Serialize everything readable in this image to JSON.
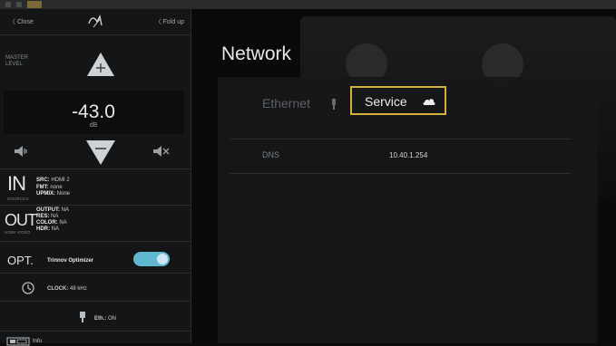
{
  "sidebar": {
    "close_label": "〈 Close",
    "fold_label": "〈 Fold up",
    "master_level_label_1": "MASTER",
    "master_level_label_2": "LEVEL",
    "volume_value": "-43.0",
    "volume_unit": "dB",
    "input": {
      "big": "IN",
      "sub": "SOURCES",
      "lines": [
        {
          "key": "SRC:",
          "value": "HDMI 2"
        },
        {
          "key": "FMT:",
          "value": "none"
        },
        {
          "key": "UPMIX:",
          "value": "None"
        }
      ]
    },
    "output": {
      "big": "OUT",
      "sub": "HDMI VIDEO",
      "lines": [
        {
          "key": "OUTPUT:",
          "value": "NA"
        },
        {
          "key": "RES:",
          "value": "NA"
        },
        {
          "key": "COLOR:",
          "value": "NA"
        },
        {
          "key": "HDR:",
          "value": "NA"
        }
      ]
    },
    "optimizer": {
      "big": "OPT.",
      "label": "Trinnov Optimizer",
      "enabled": true
    },
    "clock": {
      "key": "CLOCK:",
      "value": "48 kHz"
    },
    "eth": {
      "key": "Eth.:",
      "value": "ON"
    },
    "info_label": "Info"
  },
  "main": {
    "title": "Network",
    "tabs": [
      {
        "label": "Ethernet",
        "icon": "ethernet-icon",
        "active": false
      },
      {
        "label": "Service",
        "icon": "cloud-icon",
        "active": true
      }
    ],
    "rows": [
      {
        "label": "DNS",
        "value": "10.40.1.254"
      }
    ]
  },
  "colors": {
    "accent_highlight": "#d4b13a",
    "toggle_on": "#5fb8d0"
  }
}
